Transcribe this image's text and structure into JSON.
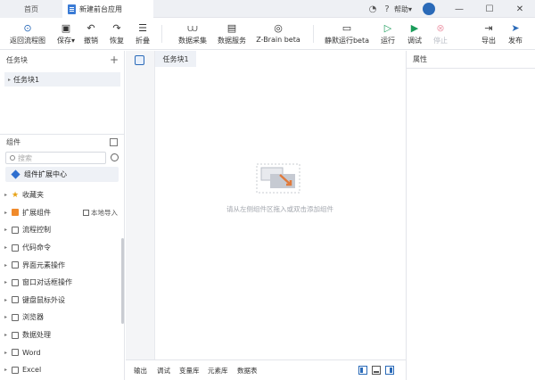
{
  "tabs": {
    "home": "首页",
    "doc": "新建前台应用"
  },
  "titlebar": {
    "help": "帮助",
    "help_caret": "▾",
    "minimize": "—",
    "maximize": "☐",
    "close": "✕"
  },
  "toolbar": {
    "back": "返回流程图",
    "save": "保存",
    "save_caret": "▾",
    "undo": "撤销",
    "redo": "恢复",
    "fold": "折叠",
    "data_collect": "数据采集",
    "data_service": "数据服务",
    "zbrain": "Z-Brain beta",
    "silent_run": "静默运行beta",
    "run": "运行",
    "debug": "调试",
    "stop": "停止",
    "export": "导出",
    "publish": "发布"
  },
  "left": {
    "task_header": "任务块",
    "task_item": "任务块1",
    "comp_header": "组件",
    "search_placeholder": "搜索",
    "ext_center": "组件扩展中心",
    "local_import": "本地导入",
    "items": [
      "收藏夹",
      "扩展组件",
      "流程控制",
      "代码命令",
      "界面元素操作",
      "窗口对话框操作",
      "键盘鼠标外设",
      "浏览器",
      "数据处理",
      "Word",
      "Excel"
    ]
  },
  "editor": {
    "tab": "任务块1",
    "empty_msg": "请从左侧组件区拖入或双击添加组件"
  },
  "right": {
    "header": "属性"
  },
  "bottom": {
    "tabs": [
      "输出",
      "调试",
      "变量库",
      "元素库",
      "数据表"
    ]
  },
  "colors": {
    "accent": "#2a6ab8",
    "run": "#1a9c5a",
    "favorite": "#e8a317",
    "extension": "#f08a2b"
  }
}
